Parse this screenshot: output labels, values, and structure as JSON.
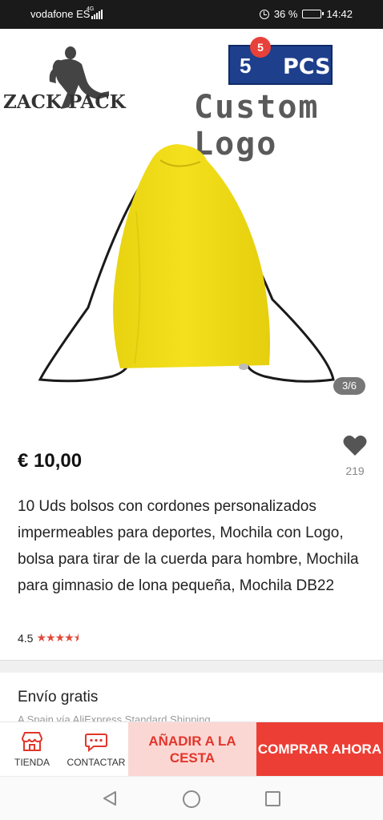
{
  "status_bar": {
    "carrier": "vodafone ES",
    "network": "4G",
    "battery_percent": "36 %",
    "battery_level": 0.36,
    "time": "14:42"
  },
  "header": {
    "back_icon": "arrow-left-icon",
    "menu_icon": "more-vertical-icon",
    "badge_count": "5"
  },
  "gallery": {
    "brand_text": "ZACK PACK",
    "pcs_number": "5",
    "pcs_label": "PCS",
    "custom_logo_text": "Custom Logo",
    "page_indicator": "3/6",
    "bag_color": "#f4e01c"
  },
  "product": {
    "price": "€ 10,00",
    "wishlist_count": "219",
    "title": "10 Uds bolsos con cordones personalizados impermeables para deportes, Mochila con Logo, bolsa para tirar de la cuerda para hombre, Mochila para gimnasio de lona pequeña, Mochila DB22",
    "rating": "4.5",
    "rating_value": 4.5
  },
  "shipping": {
    "title": "Envío gratis",
    "subtitle": "A Spain vía AliExpress Standard Shipping"
  },
  "action_bar": {
    "store_label": "TIENDA",
    "contact_label": "CONTACTAR",
    "add_to_cart_label": "AÑADIR A LA CESTA",
    "buy_now_label": "COMPRAR AHORA"
  },
  "colors": {
    "accent": "#ec3e34",
    "accent_light": "#fbd7d4",
    "pcs_blue": "#1e3f8c"
  }
}
